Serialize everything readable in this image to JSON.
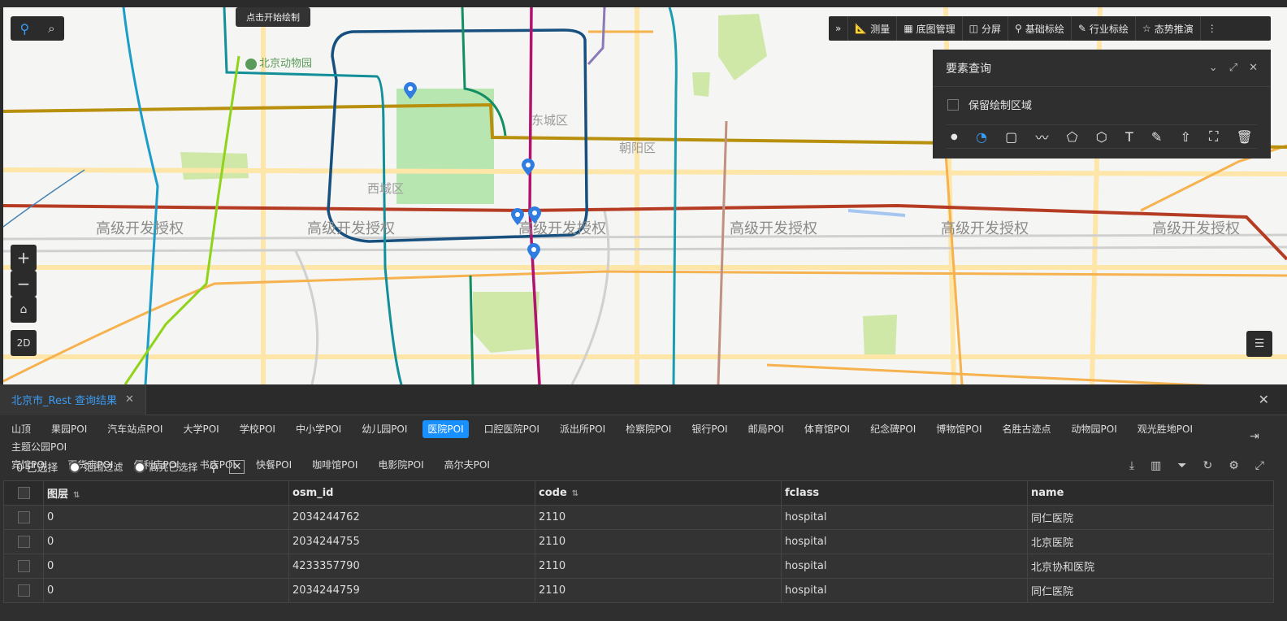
{
  "map": {
    "tooltip": "点击开始绘制",
    "zoo_label": "北京动物园",
    "districts": [
      "东城区",
      "西城区",
      "朝阳区"
    ],
    "watermark": "高级开发授权",
    "view_mode": "2D"
  },
  "toolbar": {
    "items": [
      {
        "icon": "expand-icon",
        "label": ""
      },
      {
        "icon": "measure-icon",
        "label": "测量"
      },
      {
        "icon": "basemap-icon",
        "label": "底图管理"
      },
      {
        "icon": "split-screen-icon",
        "label": "分屏"
      },
      {
        "icon": "location-pin-icon",
        "label": "基础标绘"
      },
      {
        "icon": "pen-icon",
        "label": "行业标绘"
      },
      {
        "icon": "star-icon",
        "label": "态势推演"
      },
      {
        "icon": "more-icon",
        "label": ""
      }
    ]
  },
  "query_panel": {
    "title": "要素查询",
    "keep_region_label": "保留绘制区域",
    "tools": [
      "point-icon",
      "circle-icon",
      "rectangle-icon",
      "polyline-icon",
      "polygon-icon",
      "cube-icon",
      "text-icon",
      "edit-icon",
      "upload-icon",
      "map-tool-icon",
      "trash-icon"
    ]
  },
  "results": {
    "tab_label": "北京市_Rest 查询结果",
    "categories": [
      "山顶",
      "果园POI",
      "汽车站点POI",
      "大学POI",
      "学校POI",
      "中小学POI",
      "幼儿园POI",
      "医院POI",
      "口腔医院POI",
      "派出所POI",
      "检察院POI",
      "银行POI",
      "邮局POI",
      "体育馆POI",
      "纪念碑POI",
      "博物馆POI",
      "名胜古迹点",
      "动物园POI",
      "观光胜地POI",
      "主题公园POI",
      "宾馆POI",
      "百货店POI",
      "便利店POI",
      "书店POI",
      "快餐POI",
      "咖啡馆POI",
      "电影院POI",
      "高尔夫POI"
    ],
    "selected_category": "医院POI",
    "selected_count": "0 已选择",
    "range_filter": "范围过滤",
    "highlight_selected": "高亮已选择",
    "columns": [
      "图层",
      "osm_id",
      "code",
      "fclass",
      "name"
    ],
    "rows": [
      [
        "0",
        "2034244762",
        "2110",
        "hospital",
        "同仁医院"
      ],
      [
        "0",
        "2034244755",
        "2110",
        "hospital",
        "北京医院"
      ],
      [
        "0",
        "4233357790",
        "2110",
        "hospital",
        "北京协和医院"
      ],
      [
        "0",
        "2034244759",
        "2110",
        "hospital",
        "同仁医院"
      ]
    ]
  },
  "colors": {
    "accent": "#1890ff",
    "panel_bg": "#2f2f2f",
    "pin": "#2f7de1"
  }
}
